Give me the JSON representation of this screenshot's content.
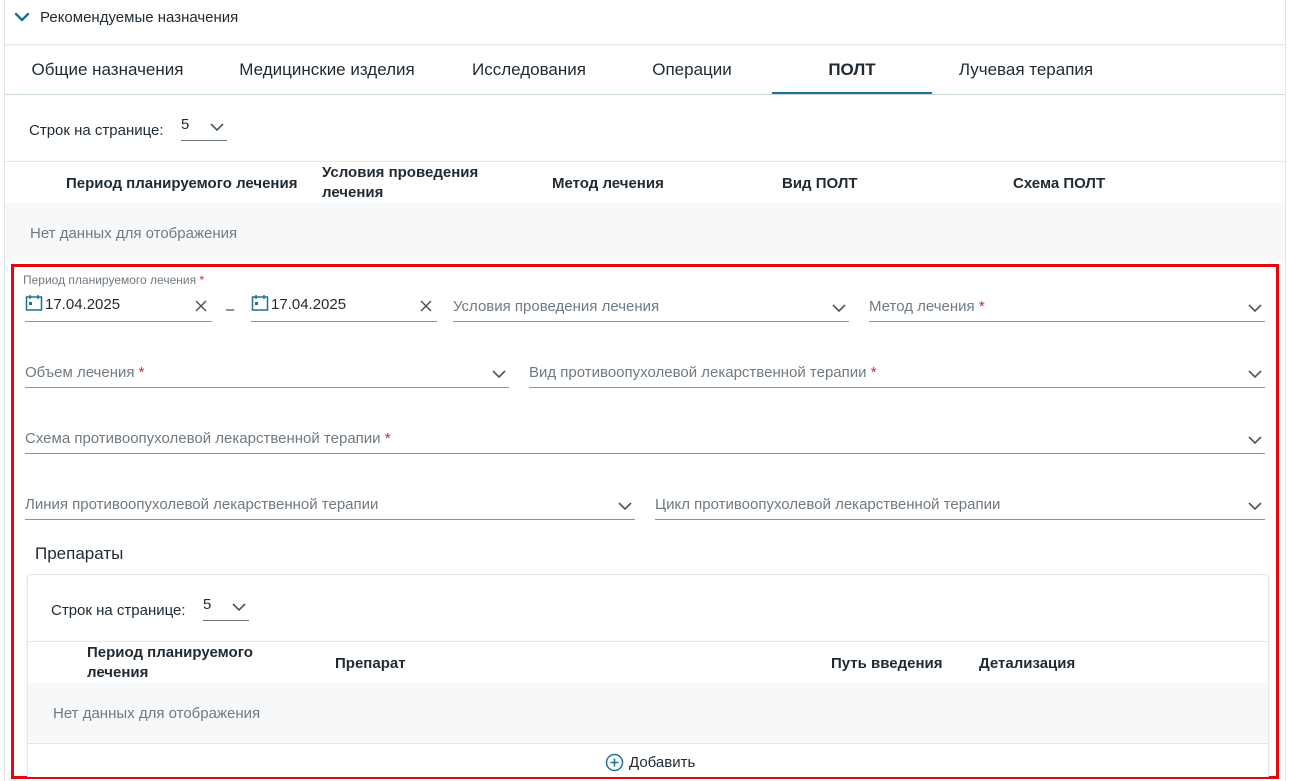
{
  "section": {
    "title": "Рекомендуемые назначения"
  },
  "tabs": [
    {
      "label": "Общие назначения"
    },
    {
      "label": "Медицинские изделия"
    },
    {
      "label": "Исследования"
    },
    {
      "label": "Операции"
    },
    {
      "label": "ПОЛТ",
      "active": true
    },
    {
      "label": "Лучевая терапия"
    }
  ],
  "main_table": {
    "rows_per_page_label": "Строк на странице:",
    "rows_per_page_value": "5",
    "columns": [
      "Период планируемого лечения",
      "Условия проведения лечения",
      "Метод лечения",
      "Вид ПОЛТ",
      "Схема ПОЛТ"
    ],
    "empty_text": "Нет данных для отображения"
  },
  "form": {
    "period_label": "Период планируемого лечения",
    "date_from": "17.04.2025",
    "date_to": "17.04.2025",
    "date_separator": "–",
    "required_mark": "*",
    "conditions_placeholder": "Условия проведения лечения",
    "method_placeholder": "Метод лечения",
    "volume_placeholder": "Объем лечения",
    "polt_type_placeholder": "Вид противоопухолевой лекарственной терапии",
    "scheme_placeholder": "Схема противоопухолевой лекарственной терапии",
    "line_placeholder": "Линия противоопухолевой лекарственной терапии",
    "cycle_placeholder": "Цикл противоопухолевой лекарственной терапии",
    "drugs_heading": "Препараты"
  },
  "drugs_table": {
    "rows_per_page_label": "Строк на странице:",
    "rows_per_page_value": "5",
    "columns": [
      "Период планируемого лечения",
      "Препарат",
      "Путь введения",
      "Детализация"
    ],
    "empty_text": "Нет данных для отображения",
    "add_label": "Добавить"
  },
  "colors": {
    "accent": "#1c7391",
    "highlight_frame": "#e8050c",
    "required": "#e0202f"
  }
}
